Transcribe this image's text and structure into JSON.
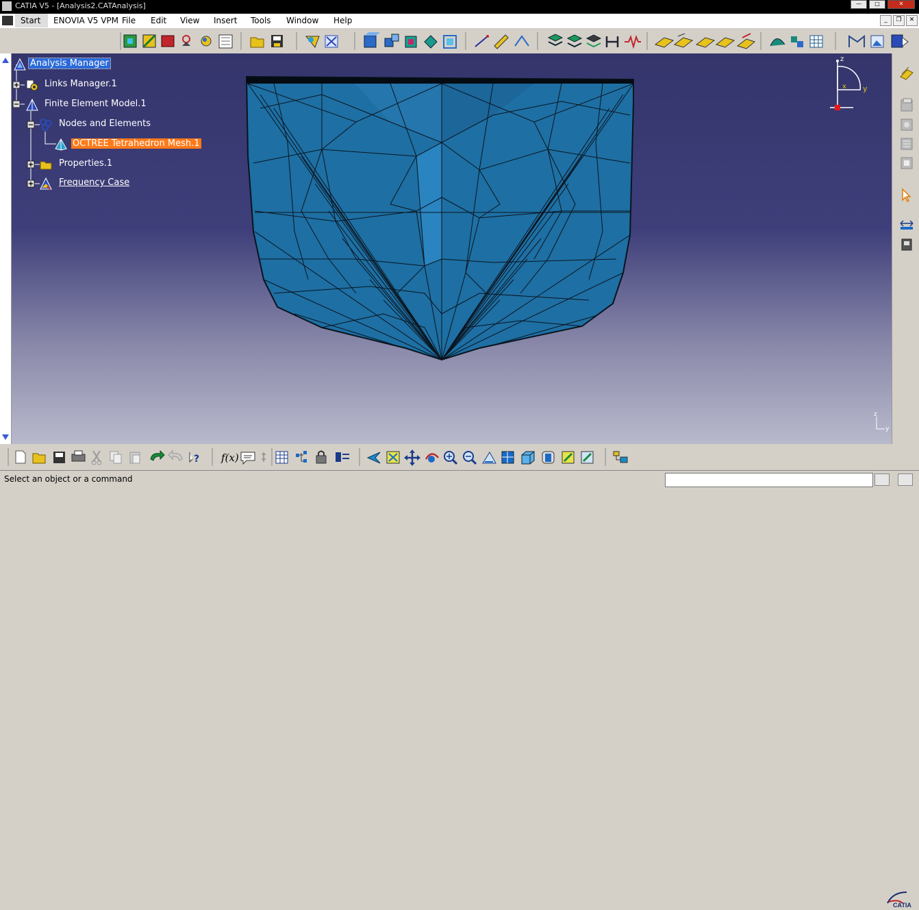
{
  "window": {
    "title": "CATIA V5 - [Analysis2.CATAnalysis]"
  },
  "menu": {
    "items": [
      "Start",
      "ENOVIA V5 VPM",
      "File",
      "Edit",
      "View",
      "Insert",
      "Tools",
      "Window",
      "Help"
    ]
  },
  "tree": {
    "root": "Analysis Manager",
    "links_manager": "Links Manager.1",
    "fem": "Finite Element Model.1",
    "nodes": "Nodes and Elements",
    "mesh": "OCTREE Tetrahedron Mesh.1",
    "properties": "Properties.1",
    "frequency": "Frequency Case"
  },
  "compass": {
    "z": "z",
    "x": "x",
    "y": "y"
  },
  "small_axes": {
    "z": "z",
    "y": "y"
  },
  "logo": {
    "text": "CATIA"
  },
  "status": {
    "text": "Select an object or a command",
    "command_value": ""
  },
  "colors": {
    "mesh_fill": "#1e6fa3",
    "mesh_edge": "#0a1a26",
    "selection": "#2b6ad8",
    "highlight": "#ff7a1a"
  }
}
